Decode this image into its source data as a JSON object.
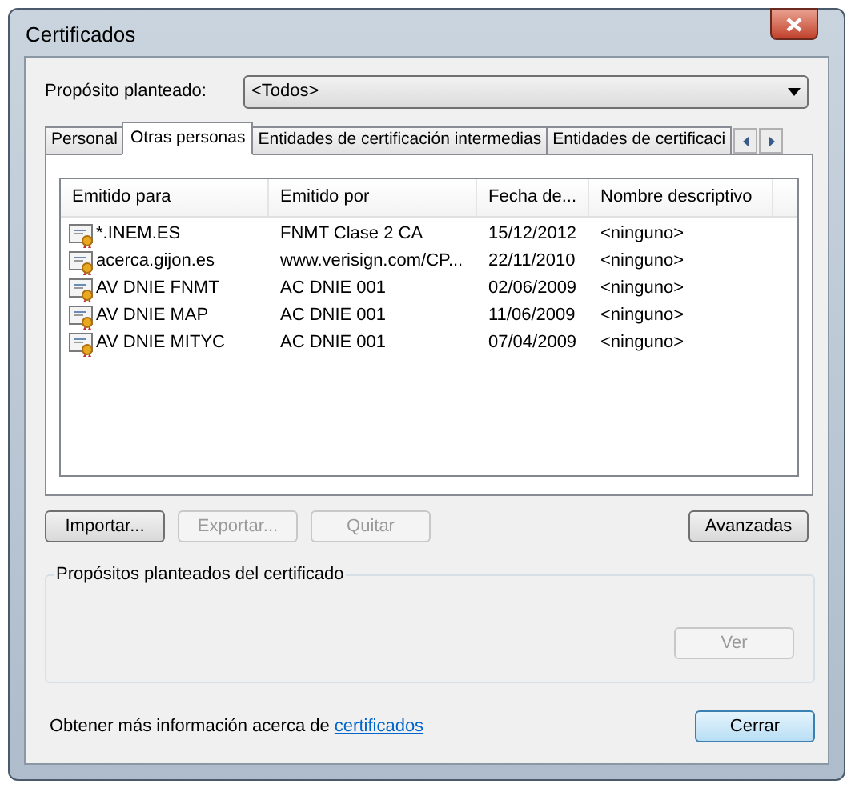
{
  "window": {
    "title": "Certificados"
  },
  "purpose": {
    "label": "Propósito planteado:",
    "value": "<Todos>"
  },
  "tabs": [
    {
      "label": "Personal",
      "selected": false
    },
    {
      "label": "Otras personas",
      "selected": true
    },
    {
      "label": "Entidades de certificación intermedias",
      "selected": false
    },
    {
      "label": "Entidades de certificaci",
      "selected": false
    }
  ],
  "table": {
    "columns": [
      "Emitido para",
      "Emitido por",
      "Fecha de...",
      "Nombre descriptivo"
    ],
    "rows": [
      [
        "*.INEM.ES",
        "FNMT Clase 2 CA",
        "15/12/2012",
        "<ninguno>"
      ],
      [
        "acerca.gijon.es",
        "www.verisign.com/CP...",
        "22/11/2010",
        "<ninguno>"
      ],
      [
        "AV DNIE FNMT",
        "AC DNIE 001",
        "02/06/2009",
        "<ninguno>"
      ],
      [
        "AV DNIE MAP",
        "AC DNIE 001",
        "11/06/2009",
        "<ninguno>"
      ],
      [
        "AV DNIE MITYC",
        "AC DNIE 001",
        "07/04/2009",
        "<ninguno>"
      ]
    ]
  },
  "actions": [
    {
      "label": "Importar...",
      "disabled": false
    },
    {
      "label": "Exportar...",
      "disabled": true
    },
    {
      "label": "Quitar",
      "disabled": true
    }
  ],
  "advanced": {
    "label": "Avanzadas",
    "disabled": false
  },
  "purposes_group": {
    "title": "Propósitos planteados del certificado",
    "button": {
      "label": "Ver",
      "disabled": true
    }
  },
  "footer": {
    "text": "Obtener más información acerca de",
    "link": "certificados"
  },
  "close": {
    "label": "Cerrar",
    "default": true
  }
}
